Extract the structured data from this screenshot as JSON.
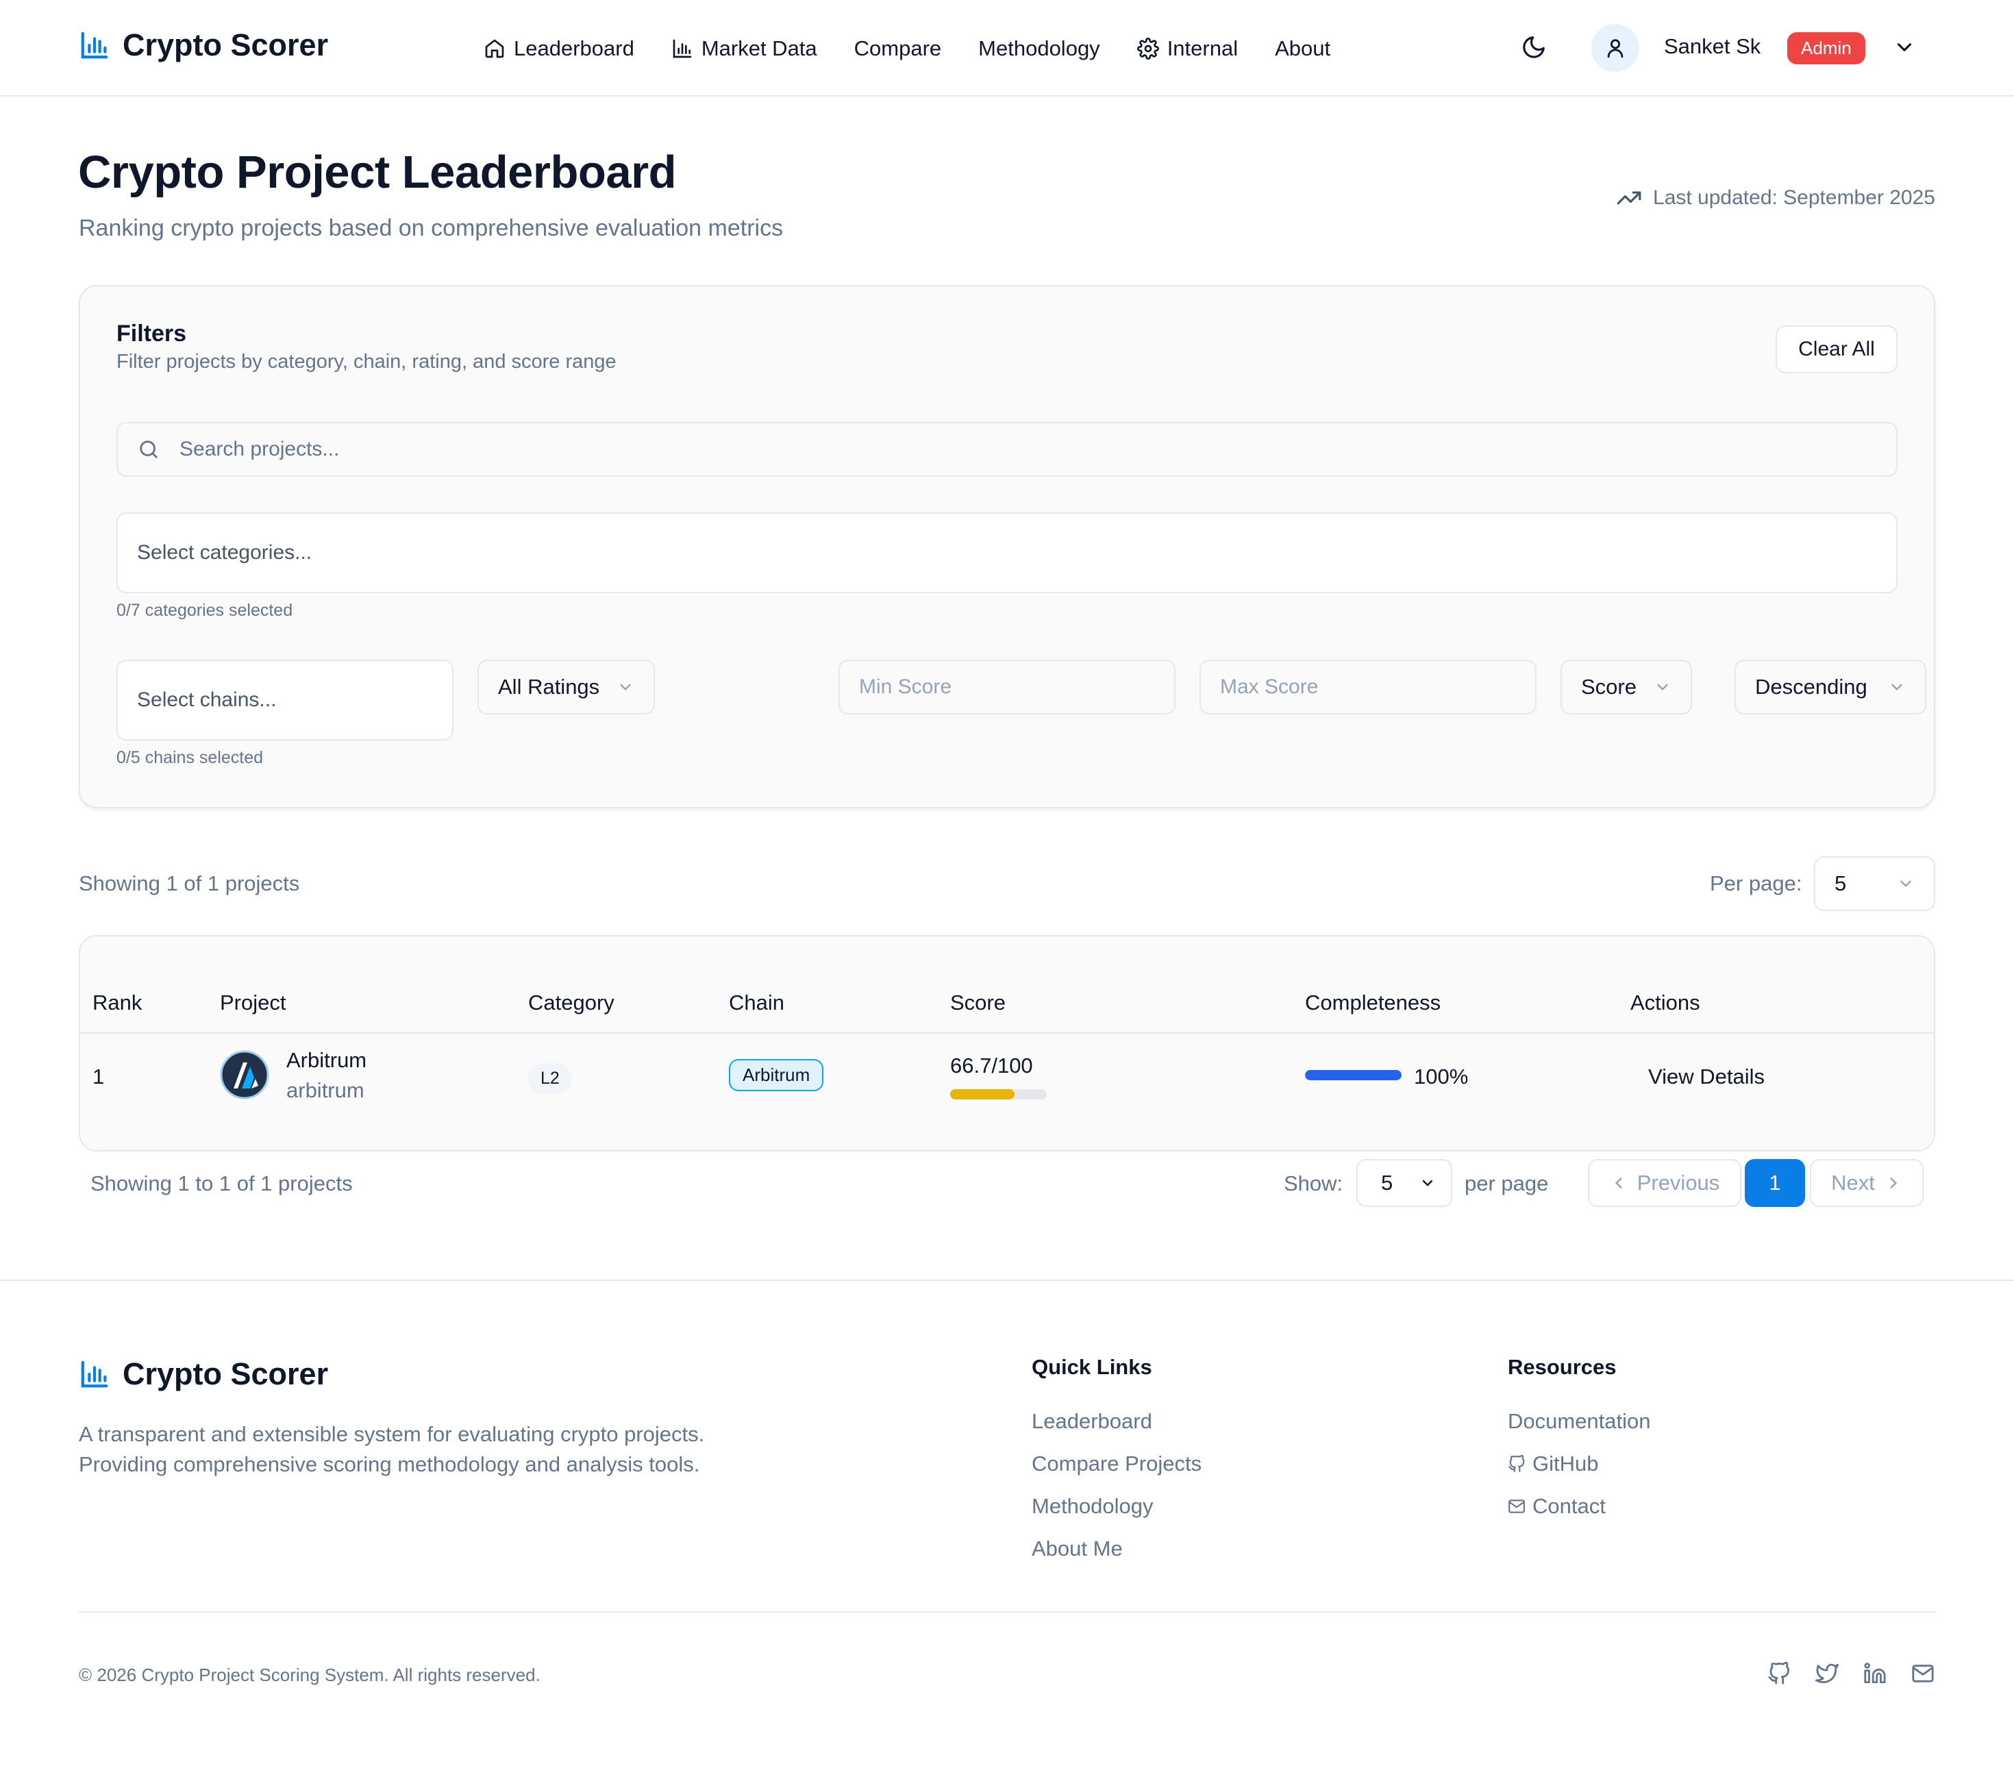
{
  "header": {
    "brand": "Crypto Scorer",
    "nav": [
      {
        "label": "Leaderboard",
        "icon": "home-icon"
      },
      {
        "label": "Market Data",
        "icon": "bar-chart-icon"
      },
      {
        "label": "Compare",
        "icon": ""
      },
      {
        "label": "Methodology",
        "icon": ""
      },
      {
        "label": "Internal",
        "icon": "gear-icon"
      },
      {
        "label": "About",
        "icon": ""
      }
    ],
    "user_name": "Sanket Sk",
    "user_role": "Admin"
  },
  "page": {
    "title": "Crypto Project Leaderboard",
    "subtitle": "Ranking crypto projects based on comprehensive evaluation metrics",
    "last_updated": "Last updated: September 2025"
  },
  "filters": {
    "title": "Filters",
    "subtitle": "Filter projects by category, chain, rating, and score range",
    "clear_label": "Clear All",
    "search_placeholder": "Search projects...",
    "categories_placeholder": "Select categories...",
    "categories_hint": "0/7 categories selected",
    "chains_placeholder": "Select chains...",
    "chains_hint": "0/5 chains selected",
    "rating_value": "All Ratings",
    "min_score_placeholder": "Min Score",
    "max_score_placeholder": "Max Score",
    "sort_by": "Score",
    "sort_order": "Descending"
  },
  "results": {
    "showing": "Showing 1 of 1 projects",
    "per_page_label": "Per page:",
    "per_page_value": "5"
  },
  "table": {
    "headers": [
      "Rank",
      "Project",
      "Category",
      "Chain",
      "Score",
      "Completeness",
      "Actions"
    ],
    "rows": [
      {
        "rank": "1",
        "name": "Arbitrum",
        "slug": "arbitrum",
        "category": "L2",
        "chain": "Arbitrum",
        "score_text": "66.7/100",
        "score_value": 66.7,
        "completeness_text": "100%",
        "completeness_value": 100,
        "action": "View Details"
      }
    ]
  },
  "pagination": {
    "summary": "Showing 1 to 1 of 1 projects",
    "show_label": "Show:",
    "show_value": "5",
    "per_page_suffix": "per page",
    "prev": "Previous",
    "current": "1",
    "next": "Next"
  },
  "footer": {
    "brand": "Crypto Scorer",
    "description_line1": "A transparent and extensible system for evaluating crypto projects.",
    "description_line2": "Providing comprehensive scoring methodology and analysis tools.",
    "quick_links_title": "Quick Links",
    "quick_links": [
      "Leaderboard",
      "Compare Projects",
      "Methodology",
      "About Me"
    ],
    "resources_title": "Resources",
    "resources": [
      "Documentation",
      "GitHub",
      "Contact"
    ],
    "copyright": "© 2026 Crypto Project Scoring System. All rights reserved."
  },
  "colors": {
    "accent": "#0b7de6",
    "admin_badge": "#ef4444",
    "score_bar": "#eab308",
    "completeness_bar": "#2563eb"
  }
}
